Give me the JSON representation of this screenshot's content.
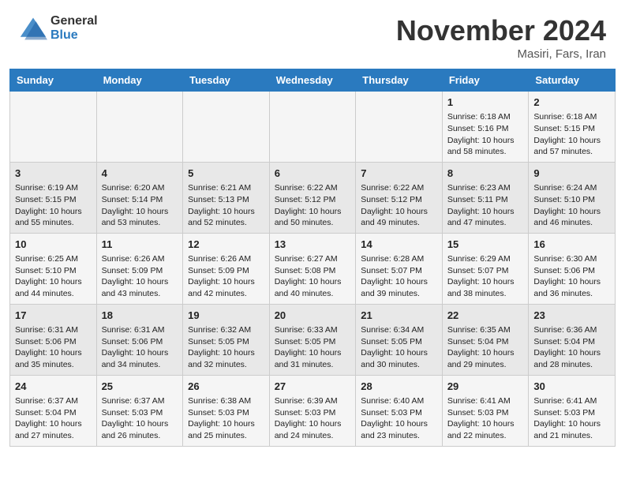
{
  "header": {
    "logo_line1": "General",
    "logo_line2": "Blue",
    "month": "November 2024",
    "location": "Masiri, Fars, Iran"
  },
  "weekdays": [
    "Sunday",
    "Monday",
    "Tuesday",
    "Wednesday",
    "Thursday",
    "Friday",
    "Saturday"
  ],
  "weeks": [
    [
      {
        "day": "",
        "info": ""
      },
      {
        "day": "",
        "info": ""
      },
      {
        "day": "",
        "info": ""
      },
      {
        "day": "",
        "info": ""
      },
      {
        "day": "",
        "info": ""
      },
      {
        "day": "1",
        "info": "Sunrise: 6:18 AM\nSunset: 5:16 PM\nDaylight: 10 hours\nand 58 minutes."
      },
      {
        "day": "2",
        "info": "Sunrise: 6:18 AM\nSunset: 5:15 PM\nDaylight: 10 hours\nand 57 minutes."
      }
    ],
    [
      {
        "day": "3",
        "info": "Sunrise: 6:19 AM\nSunset: 5:15 PM\nDaylight: 10 hours\nand 55 minutes."
      },
      {
        "day": "4",
        "info": "Sunrise: 6:20 AM\nSunset: 5:14 PM\nDaylight: 10 hours\nand 53 minutes."
      },
      {
        "day": "5",
        "info": "Sunrise: 6:21 AM\nSunset: 5:13 PM\nDaylight: 10 hours\nand 52 minutes."
      },
      {
        "day": "6",
        "info": "Sunrise: 6:22 AM\nSunset: 5:12 PM\nDaylight: 10 hours\nand 50 minutes."
      },
      {
        "day": "7",
        "info": "Sunrise: 6:22 AM\nSunset: 5:12 PM\nDaylight: 10 hours\nand 49 minutes."
      },
      {
        "day": "8",
        "info": "Sunrise: 6:23 AM\nSunset: 5:11 PM\nDaylight: 10 hours\nand 47 minutes."
      },
      {
        "day": "9",
        "info": "Sunrise: 6:24 AM\nSunset: 5:10 PM\nDaylight: 10 hours\nand 46 minutes."
      }
    ],
    [
      {
        "day": "10",
        "info": "Sunrise: 6:25 AM\nSunset: 5:10 PM\nDaylight: 10 hours\nand 44 minutes."
      },
      {
        "day": "11",
        "info": "Sunrise: 6:26 AM\nSunset: 5:09 PM\nDaylight: 10 hours\nand 43 minutes."
      },
      {
        "day": "12",
        "info": "Sunrise: 6:26 AM\nSunset: 5:09 PM\nDaylight: 10 hours\nand 42 minutes."
      },
      {
        "day": "13",
        "info": "Sunrise: 6:27 AM\nSunset: 5:08 PM\nDaylight: 10 hours\nand 40 minutes."
      },
      {
        "day": "14",
        "info": "Sunrise: 6:28 AM\nSunset: 5:07 PM\nDaylight: 10 hours\nand 39 minutes."
      },
      {
        "day": "15",
        "info": "Sunrise: 6:29 AM\nSunset: 5:07 PM\nDaylight: 10 hours\nand 38 minutes."
      },
      {
        "day": "16",
        "info": "Sunrise: 6:30 AM\nSunset: 5:06 PM\nDaylight: 10 hours\nand 36 minutes."
      }
    ],
    [
      {
        "day": "17",
        "info": "Sunrise: 6:31 AM\nSunset: 5:06 PM\nDaylight: 10 hours\nand 35 minutes."
      },
      {
        "day": "18",
        "info": "Sunrise: 6:31 AM\nSunset: 5:06 PM\nDaylight: 10 hours\nand 34 minutes."
      },
      {
        "day": "19",
        "info": "Sunrise: 6:32 AM\nSunset: 5:05 PM\nDaylight: 10 hours\nand 32 minutes."
      },
      {
        "day": "20",
        "info": "Sunrise: 6:33 AM\nSunset: 5:05 PM\nDaylight: 10 hours\nand 31 minutes."
      },
      {
        "day": "21",
        "info": "Sunrise: 6:34 AM\nSunset: 5:05 PM\nDaylight: 10 hours\nand 30 minutes."
      },
      {
        "day": "22",
        "info": "Sunrise: 6:35 AM\nSunset: 5:04 PM\nDaylight: 10 hours\nand 29 minutes."
      },
      {
        "day": "23",
        "info": "Sunrise: 6:36 AM\nSunset: 5:04 PM\nDaylight: 10 hours\nand 28 minutes."
      }
    ],
    [
      {
        "day": "24",
        "info": "Sunrise: 6:37 AM\nSunset: 5:04 PM\nDaylight: 10 hours\nand 27 minutes."
      },
      {
        "day": "25",
        "info": "Sunrise: 6:37 AM\nSunset: 5:03 PM\nDaylight: 10 hours\nand 26 minutes."
      },
      {
        "day": "26",
        "info": "Sunrise: 6:38 AM\nSunset: 5:03 PM\nDaylight: 10 hours\nand 25 minutes."
      },
      {
        "day": "27",
        "info": "Sunrise: 6:39 AM\nSunset: 5:03 PM\nDaylight: 10 hours\nand 24 minutes."
      },
      {
        "day": "28",
        "info": "Sunrise: 6:40 AM\nSunset: 5:03 PM\nDaylight: 10 hours\nand 23 minutes."
      },
      {
        "day": "29",
        "info": "Sunrise: 6:41 AM\nSunset: 5:03 PM\nDaylight: 10 hours\nand 22 minutes."
      },
      {
        "day": "30",
        "info": "Sunrise: 6:41 AM\nSunset: 5:03 PM\nDaylight: 10 hours\nand 21 minutes."
      }
    ]
  ]
}
